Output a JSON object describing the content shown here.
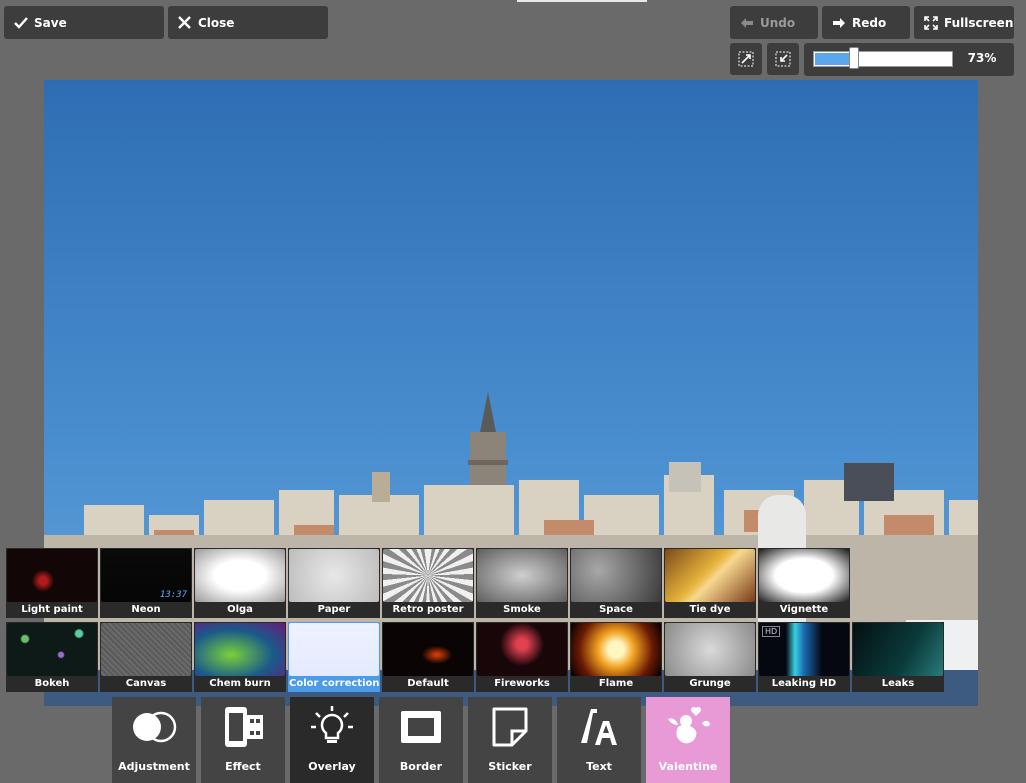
{
  "toolbar": {
    "save_label": "Save",
    "close_label": "Close",
    "undo_label": "Undo",
    "redo_label": "Redo",
    "fullscreen_label": "Fullscreen"
  },
  "zoom": {
    "value_label": "73%",
    "level": 0.3,
    "colors": {
      "fill": "#5ba7ec"
    }
  },
  "overlays": {
    "row1": [
      {
        "label": "Light paint",
        "icon": "light-paint-thumb"
      },
      {
        "label": "Neon",
        "icon": "neon-thumb",
        "caption": "13:37"
      },
      {
        "label": "Olga",
        "icon": "olga-thumb"
      },
      {
        "label": "Paper",
        "icon": "paper-thumb"
      },
      {
        "label": "Retro poster",
        "icon": "retro-poster-thumb"
      },
      {
        "label": "Smoke",
        "icon": "smoke-thumb"
      },
      {
        "label": "Space",
        "icon": "space-thumb"
      },
      {
        "label": "Tie dye",
        "icon": "tie-dye-thumb"
      },
      {
        "label": "Vignette",
        "icon": "vignette-thumb"
      }
    ],
    "row2": [
      {
        "label": "Bokeh",
        "icon": "bokeh-thumb"
      },
      {
        "label": "Canvas",
        "icon": "canvas-thumb"
      },
      {
        "label": "Chem burn",
        "icon": "chem-burn-thumb"
      },
      {
        "label": "Color correction",
        "icon": "color-correction-thumb",
        "selected": true
      },
      {
        "label": "Default",
        "icon": "default-thumb"
      },
      {
        "label": "Fireworks",
        "icon": "fireworks-thumb"
      },
      {
        "label": "Flame",
        "icon": "flame-thumb"
      },
      {
        "label": "Grunge",
        "icon": "grunge-thumb"
      },
      {
        "label": "Leaking HD",
        "icon": "leaking-hd-thumb",
        "badge": "HD"
      },
      {
        "label": "Leaks",
        "icon": "leaks-thumb"
      }
    ]
  },
  "tools": [
    {
      "label": "Adjustment",
      "icon": "adjustment-icon"
    },
    {
      "label": "Effect",
      "icon": "film-icon"
    },
    {
      "label": "Overlay",
      "icon": "lightbulb-icon",
      "active": true
    },
    {
      "label": "Border",
      "icon": "frame-icon"
    },
    {
      "label": "Sticker",
      "icon": "sticker-icon"
    },
    {
      "label": "Text",
      "icon": "text-icon"
    },
    {
      "label": "Valentine",
      "icon": "cupid-icon",
      "accent": "#e79ad6"
    }
  ]
}
